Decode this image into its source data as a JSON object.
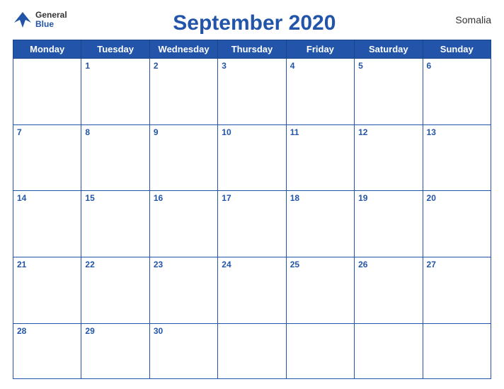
{
  "logo": {
    "general": "General",
    "blue": "Blue"
  },
  "title": "September 2020",
  "country": "Somalia",
  "weekdays": [
    "Monday",
    "Tuesday",
    "Wednesday",
    "Thursday",
    "Friday",
    "Saturday",
    "Sunday"
  ],
  "weeks": [
    [
      null,
      1,
      2,
      3,
      4,
      5,
      6
    ],
    [
      7,
      8,
      9,
      10,
      11,
      12,
      13
    ],
    [
      14,
      15,
      16,
      17,
      18,
      19,
      20
    ],
    [
      21,
      22,
      23,
      24,
      25,
      26,
      27
    ],
    [
      28,
      29,
      30,
      null,
      null,
      null,
      null
    ]
  ]
}
